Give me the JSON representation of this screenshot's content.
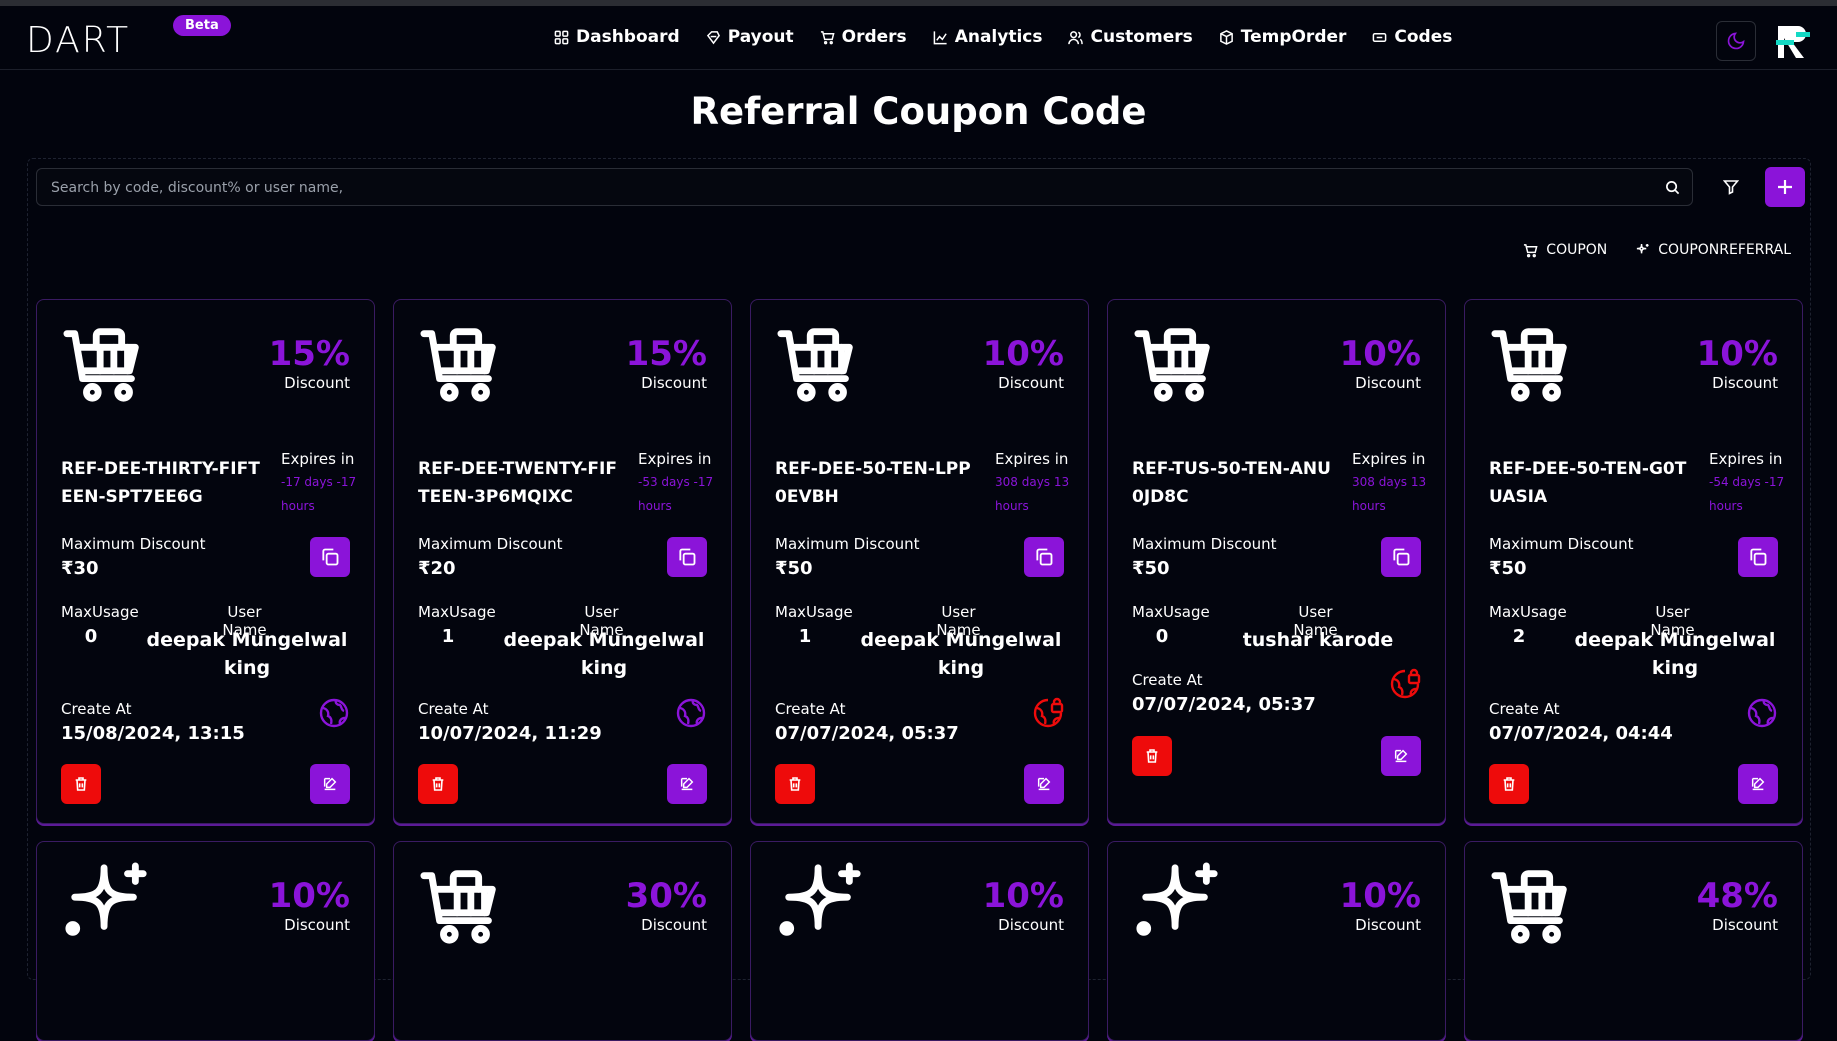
{
  "brand": {
    "logo": "DART",
    "badge": "Beta"
  },
  "nav": [
    {
      "label": "Dashboard",
      "icon": "grid-icon"
    },
    {
      "label": "Payout",
      "icon": "payout-icon"
    },
    {
      "label": "Orders",
      "icon": "cart-icon"
    },
    {
      "label": "Analytics",
      "icon": "chart-icon"
    },
    {
      "label": "Customers",
      "icon": "users-icon"
    },
    {
      "label": "TempOrder",
      "icon": "box-icon"
    },
    {
      "label": "Codes",
      "icon": "ticket-icon"
    }
  ],
  "page_title": "Referral Coupon Code",
  "search": {
    "placeholder": "Search by code, discount% or user name,"
  },
  "type_links": [
    {
      "label": "COUPON",
      "icon": "cart-icon"
    },
    {
      "label": "COUPONREFERRAL",
      "icon": "sparkle-icon"
    }
  ],
  "labels": {
    "discount": "Discount",
    "expires_in": "Expires in",
    "max_discount": "Maximum Discount",
    "max_usage": "MaxUsage",
    "user_name": "User Name",
    "create_at": "Create At"
  },
  "cards": [
    {
      "type": "cart",
      "percent": "15%",
      "code": "REF-DEE-THIRTY-FIFTEEN-SPT7EE6G",
      "expires": "-17 days -17 hours",
      "max_discount": "₹30",
      "max_usage": "0",
      "user": "deepak Mungelwal king",
      "created": "15/08/2024, 13:15",
      "status": "active"
    },
    {
      "type": "cart",
      "percent": "15%",
      "code": "REF-DEE-TWENTY-FIFTEEN-3P6MQIXC",
      "expires": "-53 days -17 hours",
      "max_discount": "₹20",
      "max_usage": "1",
      "user": "deepak Mungelwal king",
      "created": "10/07/2024, 11:29",
      "status": "active"
    },
    {
      "type": "cart",
      "percent": "10%",
      "code": "REF-DEE-50-TEN-LPP0EVBH",
      "expires": "308 days 13 hours",
      "max_discount": "₹50",
      "max_usage": "1",
      "user": "deepak Mungelwal king",
      "created": "07/07/2024, 05:37",
      "status": "locked"
    },
    {
      "type": "cart",
      "percent": "10%",
      "code": "REF-TUS-50-TEN-ANU0JD8C",
      "expires": "308 days 13 hours",
      "max_discount": "₹50",
      "max_usage": "0",
      "user": "tushar karode",
      "created": "07/07/2024, 05:37",
      "status": "locked"
    },
    {
      "type": "cart",
      "percent": "10%",
      "code": "REF-DEE-50-TEN-G0TUASIA",
      "expires": "-54 days -17 hours",
      "max_discount": "₹50",
      "max_usage": "2",
      "user": "deepak Mungelwal king",
      "created": "07/07/2024, 04:44",
      "status": "active"
    }
  ],
  "cards_row2": [
    {
      "type": "sparkle",
      "percent": "10%"
    },
    {
      "type": "cart",
      "percent": "30%"
    },
    {
      "type": "sparkle",
      "percent": "10%"
    },
    {
      "type": "sparkle",
      "percent": "10%"
    },
    {
      "type": "cart",
      "percent": "48%"
    }
  ],
  "colors": {
    "accent": "#8b14d9",
    "danger": "#ee0b0b",
    "background": "#02040d"
  }
}
